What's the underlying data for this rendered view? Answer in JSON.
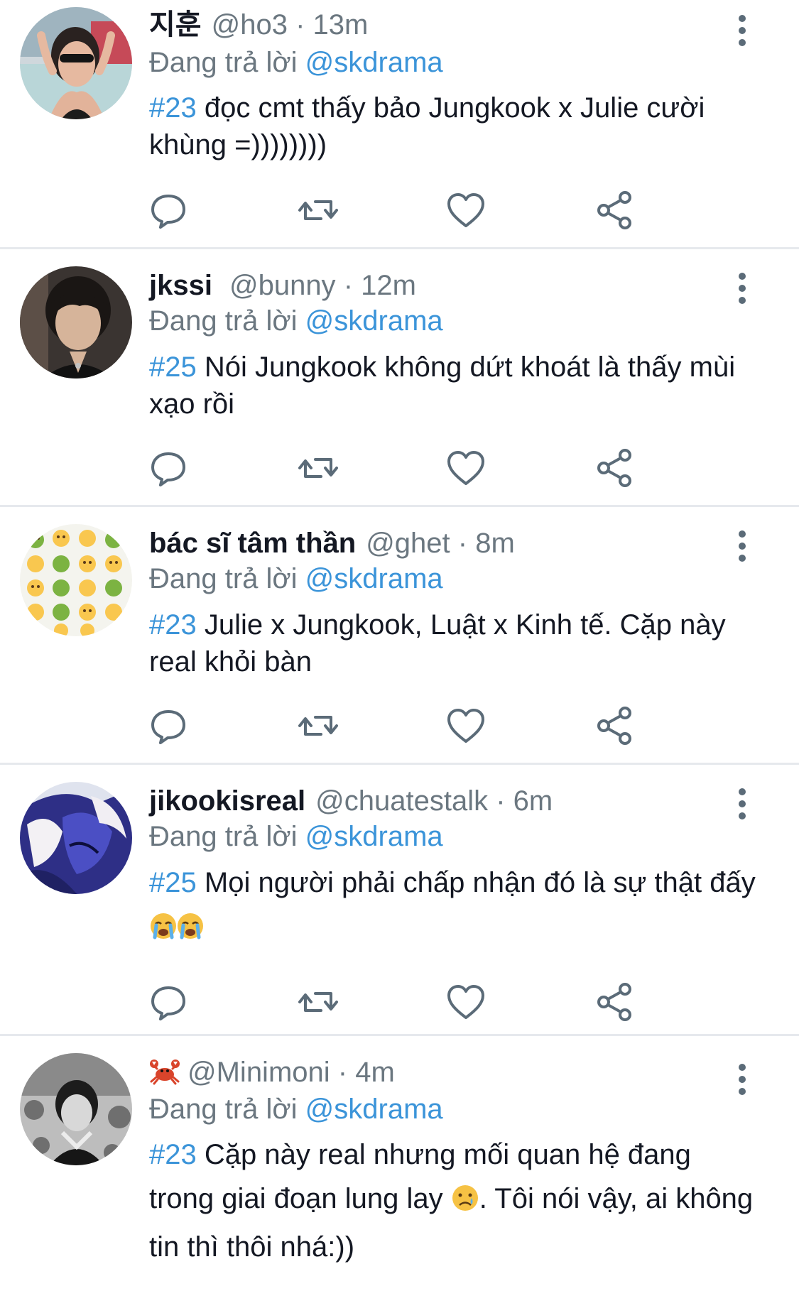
{
  "reply_prefix": "Đang trả lời",
  "tweets": [
    {
      "name": "지훈",
      "handle": "@ho3",
      "separator": "·",
      "time": "13m",
      "reply_to": "@skdrama",
      "tag": "#23",
      "text": "đọc cmt thấy bảo Jungkook x Julie cười khùng =))))))))",
      "avatar": "photo-woman-sunglasses"
    },
    {
      "name": "jkssi",
      "handle": "@bunny",
      "separator": "·",
      "time": "12m",
      "reply_to": "@skdrama",
      "tag": "#25",
      "text": "Nói Jungkook không dứt khoát là thấy mùi xạo rồi",
      "avatar": "photo-man-dark-hair"
    },
    {
      "name": "bác sĩ tâm thần",
      "handle": "@ghet",
      "separator": "·",
      "time": "8m",
      "reply_to": "@skdrama",
      "tag": "#23",
      "text": "Julie x Jungkook, Luật x Kinh tế. Cặp này real khỏi bàn",
      "avatar": "emoji-grid-pattern"
    },
    {
      "name": "jikookisreal",
      "handle": "@chuatestalk",
      "separator": "·",
      "time": "6m",
      "reply_to": "@skdrama",
      "tag": "#25",
      "text_before_emoji": "Mọi người phải chấp nhận đó là sự thật đấy",
      "emoji": "loudly-crying-face",
      "avatar": "anime-blue-illustration"
    },
    {
      "name_icon": "crab-icon",
      "handle": "@Minimoni",
      "separator": "·",
      "time": "4m",
      "reply_to": "@skdrama",
      "tag": "#23",
      "text_before_emoji": "Cặp này real nhưng mối quan hệ đang trong giai đoạn lung lay",
      "emoji": "crying-face",
      "text_after_emoji": ". Tôi nói vậy, ai không tin thì thôi nhá:))",
      "avatar": "photo-monochrome-person"
    }
  ],
  "colors": {
    "accent": "#3b94d9",
    "muted": "#6b7780",
    "text": "#141823",
    "divider": "#e6e9ed",
    "icon": "#5b6b78"
  },
  "action_icons": [
    "reply-icon",
    "retweet-icon",
    "like-icon",
    "share-icon"
  ]
}
